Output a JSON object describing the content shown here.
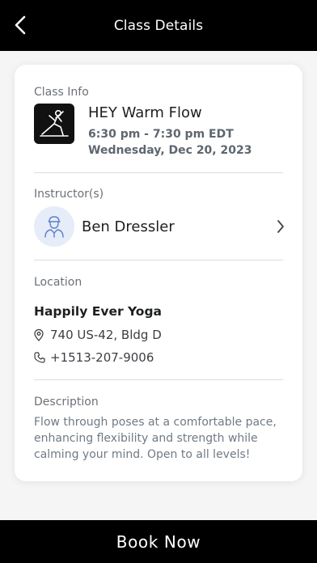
{
  "header": {
    "title": "Class Details"
  },
  "class_info": {
    "label": "Class Info",
    "name": "HEY Warm Flow",
    "time": "6:30 pm - 7:30 pm EDT",
    "date": "Wednesday, Dec 20, 2023",
    "thumbnail_icon": "yoga-pose-icon"
  },
  "instructor": {
    "label": "Instructor(s)",
    "name": "Ben Dressler",
    "avatar_icon": "person-avatar-icon"
  },
  "location": {
    "label": "Location",
    "name": "Happily Ever Yoga",
    "address": "740 US-42, Bldg D",
    "phone": "+1513-207-9006"
  },
  "description": {
    "label": "Description",
    "text": "Flow through poses at a comfortable pace, enhancing flexibility and strength while calming your mind. Open to all levels!"
  },
  "footer": {
    "book_label": "Book Now"
  },
  "colors": {
    "header_bg": "#000000",
    "footer_bg": "#000000",
    "avatar_bg": "#e6ecf8",
    "accent": "#5b7fc9"
  }
}
